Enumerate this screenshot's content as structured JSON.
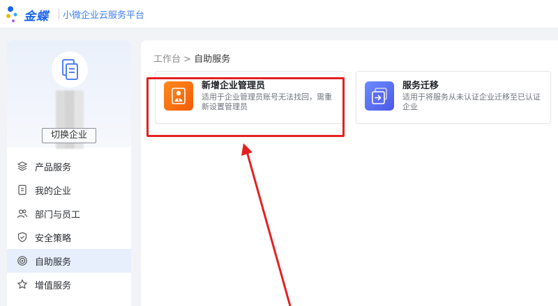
{
  "header": {
    "brand": "金蝶",
    "subtitle": "小微企业云服务平台"
  },
  "sidebar": {
    "switch_button": "切换企业",
    "items": [
      {
        "label": "产品服务",
        "icon": "layers-icon"
      },
      {
        "label": "我的企业",
        "icon": "document-icon"
      },
      {
        "label": "部门与员工",
        "icon": "users-icon"
      },
      {
        "label": "安全策略",
        "icon": "shield-icon"
      },
      {
        "label": "自助服务",
        "icon": "target-icon",
        "active": true
      },
      {
        "label": "增值服务",
        "icon": "star-icon"
      }
    ]
  },
  "breadcrumb": {
    "root": "工作台",
    "separator": ">",
    "current": "自助服务"
  },
  "cards": [
    {
      "title": "新增企业管理员",
      "desc": "适用于企业管理员账号无法找回，需重新设置管理员",
      "icon": "admin-user-icon"
    },
    {
      "title": "服务迁移",
      "desc": "适用于将服务从未认证企业迁移至已认证企业",
      "icon": "migrate-icon"
    }
  ],
  "colors": {
    "brand": "#1a64f0",
    "accent_orange": "#f35b06",
    "accent_blue": "#4b58e6",
    "highlight": "#e42020",
    "active_bg": "#e7effc"
  }
}
